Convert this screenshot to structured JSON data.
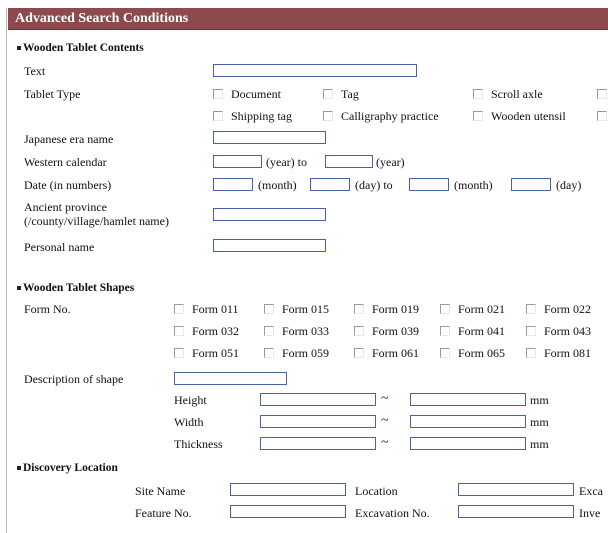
{
  "header": {
    "title": "Advanced Search Conditions"
  },
  "contents": {
    "section_title": "Wooden Tablet Contents",
    "text_label": "Text",
    "tablet_type_label": "Tablet Type",
    "tablet_types": [
      "Document",
      "Tag",
      "Scroll axle",
      "Shipping tag",
      "Calligraphy practice",
      "Wooden utensil"
    ],
    "era_label": "Japanese era name",
    "western_label": "Western calendar",
    "year_text": "(year) to",
    "year_end_text": "(year)",
    "date_label": "Date (in numbers)",
    "month_text": "(month)",
    "day_to_text": "(day) to",
    "month_text_2": "(month)",
    "day_text": "(day)",
    "province_label_1": "Ancient province",
    "province_label_2": "(/county/village/hamlet name)",
    "personal_label": "Personal name"
  },
  "shapes": {
    "section_title": "Wooden Tablet Shapes",
    "form_label": "Form No.",
    "forms": [
      [
        "Form 011",
        "Form 015",
        "Form 019",
        "Form 021",
        "Form 022"
      ],
      [
        "Form 032",
        "Form 033",
        "Form 039",
        "Form 041",
        "Form 043"
      ],
      [
        "Form 051",
        "Form 059",
        "Form 061",
        "Form 065",
        "Form 081"
      ]
    ],
    "description_label": "Description of shape",
    "dims": [
      {
        "label": "Height",
        "unit": "mm"
      },
      {
        "label": "Width",
        "unit": "mm"
      },
      {
        "label": "Thickness",
        "unit": "mm"
      }
    ],
    "tilde": "~"
  },
  "location": {
    "section_title": "Discovery Location",
    "site_label": "Site Name",
    "location_label": "Location",
    "exc_label": "Exca",
    "feature_label": "Feature No.",
    "excavation_label": "Excavation No.",
    "inv_label": "Inve"
  },
  "colors": {
    "header_bg": "#8c4a4f",
    "input_border": "#4a63a3"
  }
}
